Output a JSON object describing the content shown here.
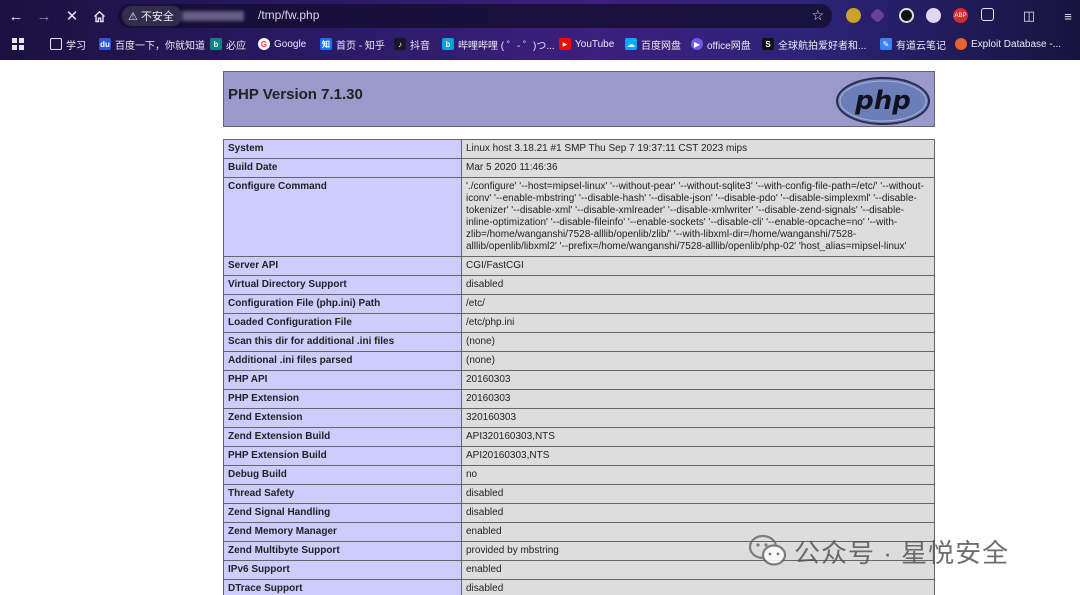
{
  "browser": {
    "security_label": "不安全",
    "url_path": "/tmp/fw.php",
    "bookmarks": [
      {
        "label": "学习",
        "icon": "folder-icon",
        "color": "#2f2a5e"
      },
      {
        "label": "百度一下，你就知道",
        "icon": "baidu-icon",
        "color": "#2f55d4"
      },
      {
        "label": "必应",
        "icon": "bing-icon",
        "color": "#0c8484"
      },
      {
        "label": "Google",
        "icon": "google-icon",
        "color": "#ea4335"
      },
      {
        "label": "首页 - 知乎",
        "icon": "zhihu-icon",
        "color": "#1772f6"
      },
      {
        "label": "抖音",
        "icon": "douyin-icon",
        "color": "#161823"
      },
      {
        "label": "哔哩哔哩 ( ゜- ゜)つ...",
        "icon": "bilibili-icon",
        "color": "#00a1d6"
      },
      {
        "label": "YouTube",
        "icon": "youtube-icon",
        "color": "#ff0000"
      },
      {
        "label": "百度网盘",
        "icon": "baidu-pan-icon",
        "color": "#06a7ff"
      },
      {
        "label": "office网盘",
        "icon": "office-icon",
        "color": "#6c5ce7"
      },
      {
        "label": "全球航拍爱好者和...",
        "icon": "skypixel-icon",
        "color": "#111111"
      },
      {
        "label": "有道云笔记",
        "icon": "youdao-icon",
        "color": "#3b82f6"
      },
      {
        "label": "Exploit Database -...",
        "icon": "exploitdb-icon",
        "color": "#e8642c"
      }
    ]
  },
  "php": {
    "title": "PHP Version 7.1.30",
    "logo_text": "php",
    "rows": [
      {
        "key": "System",
        "value": "Linux host 3.18.21 #1 SMP Thu Sep 7 19:37:11 CST 2023 mips"
      },
      {
        "key": "Build Date",
        "value": "Mar 5 2020 11:46:36"
      },
      {
        "key": "Configure Command",
        "value": "'./configure' '--host=mipsel-linux' '--without-pear' '--without-sqlite3' '--with-config-file-path=/etc/' '--without-iconv' '--enable-mbstring' '--disable-hash' '--disable-json' '--disable-pdo' '--disable-simplexml' '--disable-tokenizer' '--disable-xml' '--disable-xmlreader' '--disable-xmlwriter' '--disable-zend-signals' '--disable-inline-optimization' '--disable-fileinfo' '--enable-sockets' '--disable-cli' '--enable-opcache=no' '--with-zlib=/home/wanganshi/7528-alllib/openlib/zlib/' '--with-libxml-dir=/home/wanganshi/7528-alllib/openlib/libxml2' '--prefix=/home/wanganshi/7528-alllib/openlib/php-02' 'host_alias=mipsel-linux'"
      },
      {
        "key": "Server API",
        "value": "CGI/FastCGI"
      },
      {
        "key": "Virtual Directory Support",
        "value": "disabled"
      },
      {
        "key": "Configuration File (php.ini) Path",
        "value": "/etc/"
      },
      {
        "key": "Loaded Configuration File",
        "value": "/etc/php.ini"
      },
      {
        "key": "Scan this dir for additional .ini files",
        "value": "(none)"
      },
      {
        "key": "Additional .ini files parsed",
        "value": "(none)"
      },
      {
        "key": "PHP API",
        "value": "20160303"
      },
      {
        "key": "PHP Extension",
        "value": "20160303"
      },
      {
        "key": "Zend Extension",
        "value": "320160303"
      },
      {
        "key": "Zend Extension Build",
        "value": "API320160303,NTS"
      },
      {
        "key": "PHP Extension Build",
        "value": "API20160303,NTS"
      },
      {
        "key": "Debug Build",
        "value": "no"
      },
      {
        "key": "Thread Safety",
        "value": "disabled"
      },
      {
        "key": "Zend Signal Handling",
        "value": "disabled"
      },
      {
        "key": "Zend Memory Manager",
        "value": "enabled"
      },
      {
        "key": "Zend Multibyte Support",
        "value": "provided by mbstring"
      },
      {
        "key": "IPv6 Support",
        "value": "enabled"
      },
      {
        "key": "DTrace Support",
        "value": "disabled"
      }
    ]
  },
  "watermark": {
    "text": "公众号 · 星悦安全"
  }
}
